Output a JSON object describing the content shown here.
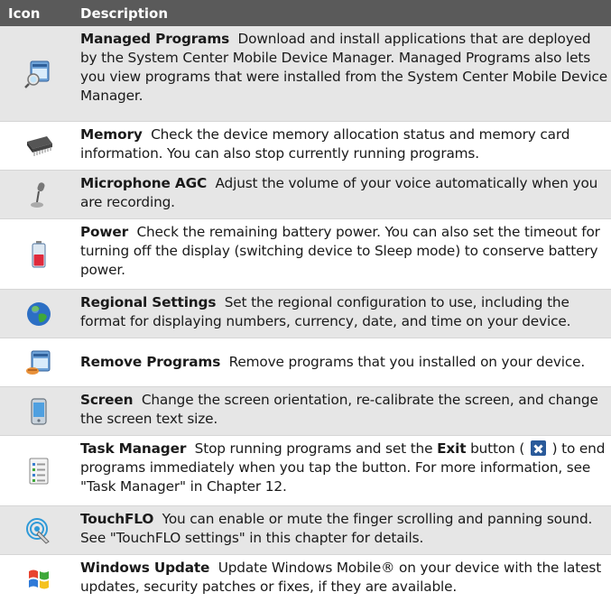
{
  "header": {
    "icon_col": "Icon",
    "desc_col": "Description"
  },
  "rows": [
    {
      "title": "Managed Programs",
      "text": "Download and install applications that are deployed by the System Center Mobile Device Manager. Managed Programs also lets you view programs that were installed from the System Center Mobile Device Manager.",
      "icon": "managed-programs-icon"
    },
    {
      "title": "Memory",
      "text": "Check the device memory allocation status and memory card information. You can also stop currently running programs.",
      "icon": "memory-chip-icon"
    },
    {
      "title": "Microphone AGC",
      "text": "Adjust the volume of your voice automatically when you are recording.",
      "icon": "microphone-icon"
    },
    {
      "title": "Power",
      "text": "Check the remaining battery power. You can also set the timeout for turning off the display (switching device to Sleep mode) to conserve battery power.",
      "icon": "battery-icon"
    },
    {
      "title": "Regional Settings",
      "text": "Set the regional configuration to use, including the format for displaying numbers, currency, date, and time on your device.",
      "icon": "globe-icon"
    },
    {
      "title": "Remove Programs",
      "text": "Remove programs that you installed on your device.",
      "icon": "remove-programs-icon"
    },
    {
      "title": "Screen",
      "text": "Change the screen orientation, re-calibrate the screen, and change the screen text size.",
      "icon": "screen-device-icon"
    },
    {
      "title": "Task Manager",
      "text_a": "Stop running programs and set the",
      "exit_label": "Exit",
      "text_b": "button (",
      "text_c": ") to end programs immediately when you tap the button. For more information, see \"Task Manager\" in Chapter 12.",
      "icon": "task-manager-icon"
    },
    {
      "title": "TouchFLO",
      "text": "You can enable or mute the finger scrolling and panning sound. See \"TouchFLO settings\" in this chapter for details.",
      "icon": "touchflo-icon"
    },
    {
      "title": "Windows Update",
      "text": "Update Windows Mobile® on your device with the latest updates, security patches or fixes, if they are available.",
      "icon": "windows-flag-icon"
    }
  ]
}
